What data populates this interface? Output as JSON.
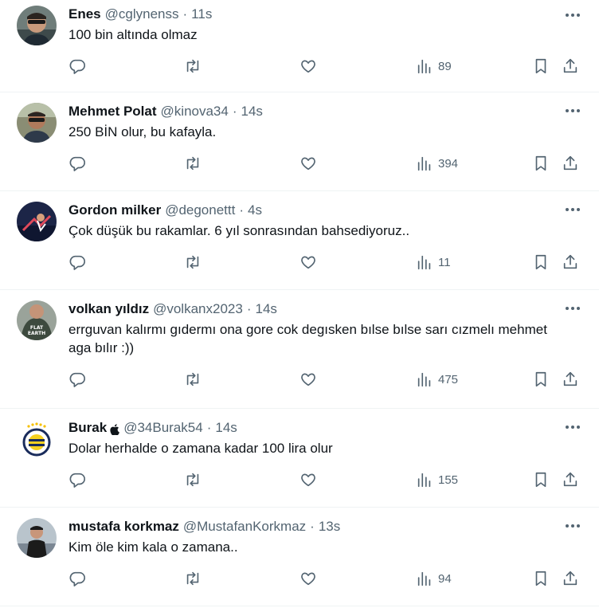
{
  "tweets": [
    {
      "name": "Enes",
      "handle": "@cglynenss",
      "time": "11s",
      "text": "100 bin altında olmaz",
      "views": "89",
      "verified_apple": false
    },
    {
      "name": "Mehmet Polat",
      "handle": "@kinova34",
      "time": "14s",
      "text": "250 BİN olur, bu kafayla.",
      "views": "394",
      "verified_apple": false
    },
    {
      "name": "Gordon milker",
      "handle": "@degonettt",
      "time": "4s",
      "text": "Çok düşük bu rakamlar. 6 yıl sonrasından bahsediyoruz..",
      "views": "11",
      "verified_apple": false
    },
    {
      "name": "volkan yıldız",
      "handle": "@volkanx2023",
      "time": "14s",
      "text": "errguvan kalırmı gıdermı ona gore cok degısken bılse bılse sarı cızmelı mehmet aga bılır :))",
      "views": "475",
      "verified_apple": false
    },
    {
      "name": "Burak",
      "handle": "@34Burak54",
      "time": "14s",
      "text": "Dolar herhalde o zamana kadar 100 lira olur",
      "views": "155",
      "verified_apple": true
    },
    {
      "name": "mustafa korkmaz",
      "handle": "@MustafanKorkmaz",
      "time": "13s",
      "text": "Kim öle kim kala o zamana..",
      "views": "94",
      "verified_apple": false
    }
  ],
  "separator": "·",
  "icons": [
    "reply-icon",
    "retweet-icon",
    "like-icon",
    "views-icon",
    "bookmark-icon",
    "share-icon",
    "more-icon"
  ],
  "colors": {
    "text": "#0f1419",
    "muted": "#536471",
    "divider": "#eff3f4"
  }
}
